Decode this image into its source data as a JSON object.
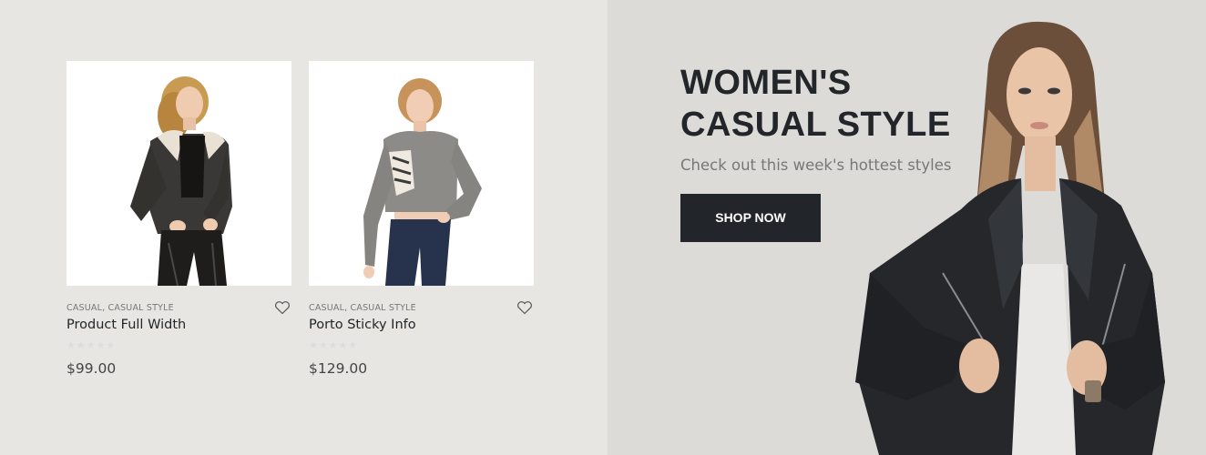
{
  "products": [
    {
      "categories": "CASUAL, CASUAL STYLE",
      "name": "Product Full Width",
      "price": "$99.00",
      "rating": 0
    },
    {
      "categories": "CASUAL, CASUAL STYLE",
      "name": "Porto Sticky Info",
      "price": "$129.00",
      "rating": 0
    }
  ],
  "banner": {
    "title_line1": "WOMEN'S",
    "title_line2": "CASUAL STYLE",
    "subtitle": "Check out this week's hottest styles",
    "button_label": "SHOP NOW"
  },
  "colors": {
    "left_bg": "#e7e6e3",
    "right_bg": "#dcdbd7",
    "dark": "#222529",
    "star_empty": "#dcdcdc"
  },
  "icons": {
    "wishlist": "heart-outline-icon",
    "rating": "star-icon"
  }
}
